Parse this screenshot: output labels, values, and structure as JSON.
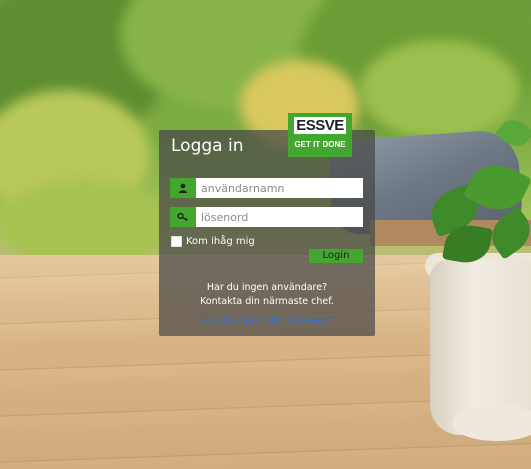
{
  "brand": {
    "name": "ESSVE",
    "tagline": "GET IT DONE",
    "color": "#43a72f"
  },
  "login": {
    "title": "Logga in",
    "username_placeholder": "användarnamn",
    "username_icon": "user-icon",
    "password_placeholder": "lösenord",
    "password_icon": "key-icon",
    "remember_label": "Kom ihåg mig",
    "submit_label": "Login",
    "no_user_line1": "Har du ingen användare?",
    "no_user_line2": "Kontakta din närmaste chef.",
    "forgot_link": "Har du glömt ditt lösenord?"
  },
  "colors": {
    "panel_bg": "rgba(70,70,70,0.72)",
    "accent": "#43a72f",
    "link": "#2a6fd8"
  }
}
